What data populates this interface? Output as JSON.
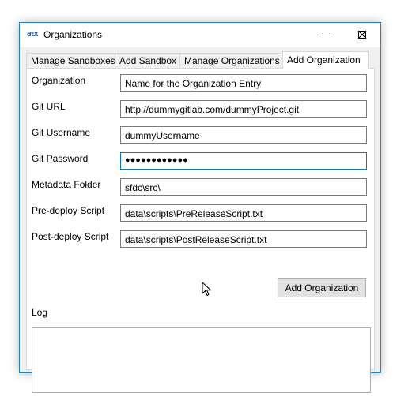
{
  "window": {
    "title": "Organizations",
    "app_icon_text": "dtX",
    "accent": "#1883d7"
  },
  "window_controls": {
    "minimize_icon": "minimize-icon",
    "maximize_icon": "maximize-icon",
    "close_icon": "close-icon"
  },
  "tabs": [
    {
      "label": "Manage Sandboxes",
      "active": false
    },
    {
      "label": "Add Sandbox",
      "active": false
    },
    {
      "label": "Manage Organizations",
      "active": false
    },
    {
      "label": "Add Organization",
      "active": true
    }
  ],
  "form": {
    "fields": [
      {
        "label": "Organization",
        "value": "Name for the Organization Entry"
      },
      {
        "label": "Git URL",
        "value": "http://dummygitlab.com/dummyProject.git"
      },
      {
        "label": "Git Username",
        "value": "dummyUsername"
      },
      {
        "label": "Git Password",
        "value": "●●●●●●●●●●●●",
        "focused": true
      },
      {
        "label": "Metadata Folder",
        "value": "sfdc\\src\\"
      },
      {
        "label": "Pre-deploy Script",
        "value": "data\\scripts\\PreReleaseScript.txt"
      },
      {
        "label": "Post-deploy Script",
        "value": "data\\scripts\\PostReleaseScript.txt"
      }
    ],
    "submit_label": "Add Organization"
  },
  "log": {
    "label": "Log",
    "content": ""
  }
}
